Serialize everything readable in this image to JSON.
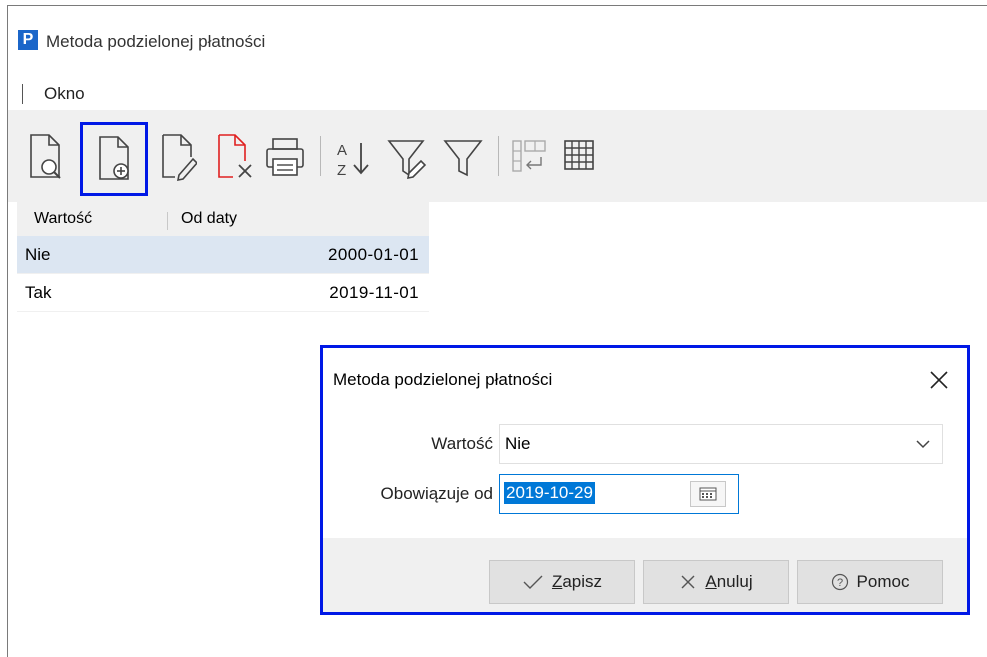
{
  "window": {
    "title": "Metoda podzielonej płatności",
    "logo_letter": "P"
  },
  "menu": {
    "items": [
      {
        "label": "Okno"
      }
    ]
  },
  "toolbar": {
    "buttons": [
      {
        "name": "preview",
        "icon": "document-preview-icon"
      },
      {
        "name": "add",
        "icon": "document-add-icon",
        "highlighted": true
      },
      {
        "name": "edit",
        "icon": "document-edit-icon"
      },
      {
        "name": "delete",
        "icon": "document-delete-icon"
      },
      {
        "name": "print",
        "icon": "printer-icon"
      },
      {
        "name": "sort",
        "icon": "sort-az-icon"
      },
      {
        "name": "filter-edit",
        "icon": "filter-edit-icon"
      },
      {
        "name": "filter",
        "icon": "filter-icon"
      },
      {
        "name": "export",
        "icon": "export-grid-icon"
      },
      {
        "name": "grid",
        "icon": "grid-icon"
      }
    ]
  },
  "grid": {
    "columns": [
      "Wartość",
      "Od daty"
    ],
    "rows": [
      {
        "value": "Nie",
        "date": "2000-01-01",
        "selected": true
      },
      {
        "value": "Tak",
        "date": "2019-11-01",
        "selected": false
      }
    ]
  },
  "dialog": {
    "title": "Metoda podzielonej płatności",
    "value_label": "Wartość",
    "value": "Nie",
    "date_label": "Obowiązuje od",
    "date_value": "2019-10-29",
    "buttons": {
      "save_mnemonic": "Z",
      "save_rest": "apisz",
      "cancel_mnemonic": "A",
      "cancel_rest": "nuluj",
      "help": "Pomoc"
    }
  },
  "colors": {
    "highlight": "#0018e6",
    "selection": "#0078d7",
    "row_selected": "#dce6f2",
    "delete_icon": "#e02020"
  }
}
